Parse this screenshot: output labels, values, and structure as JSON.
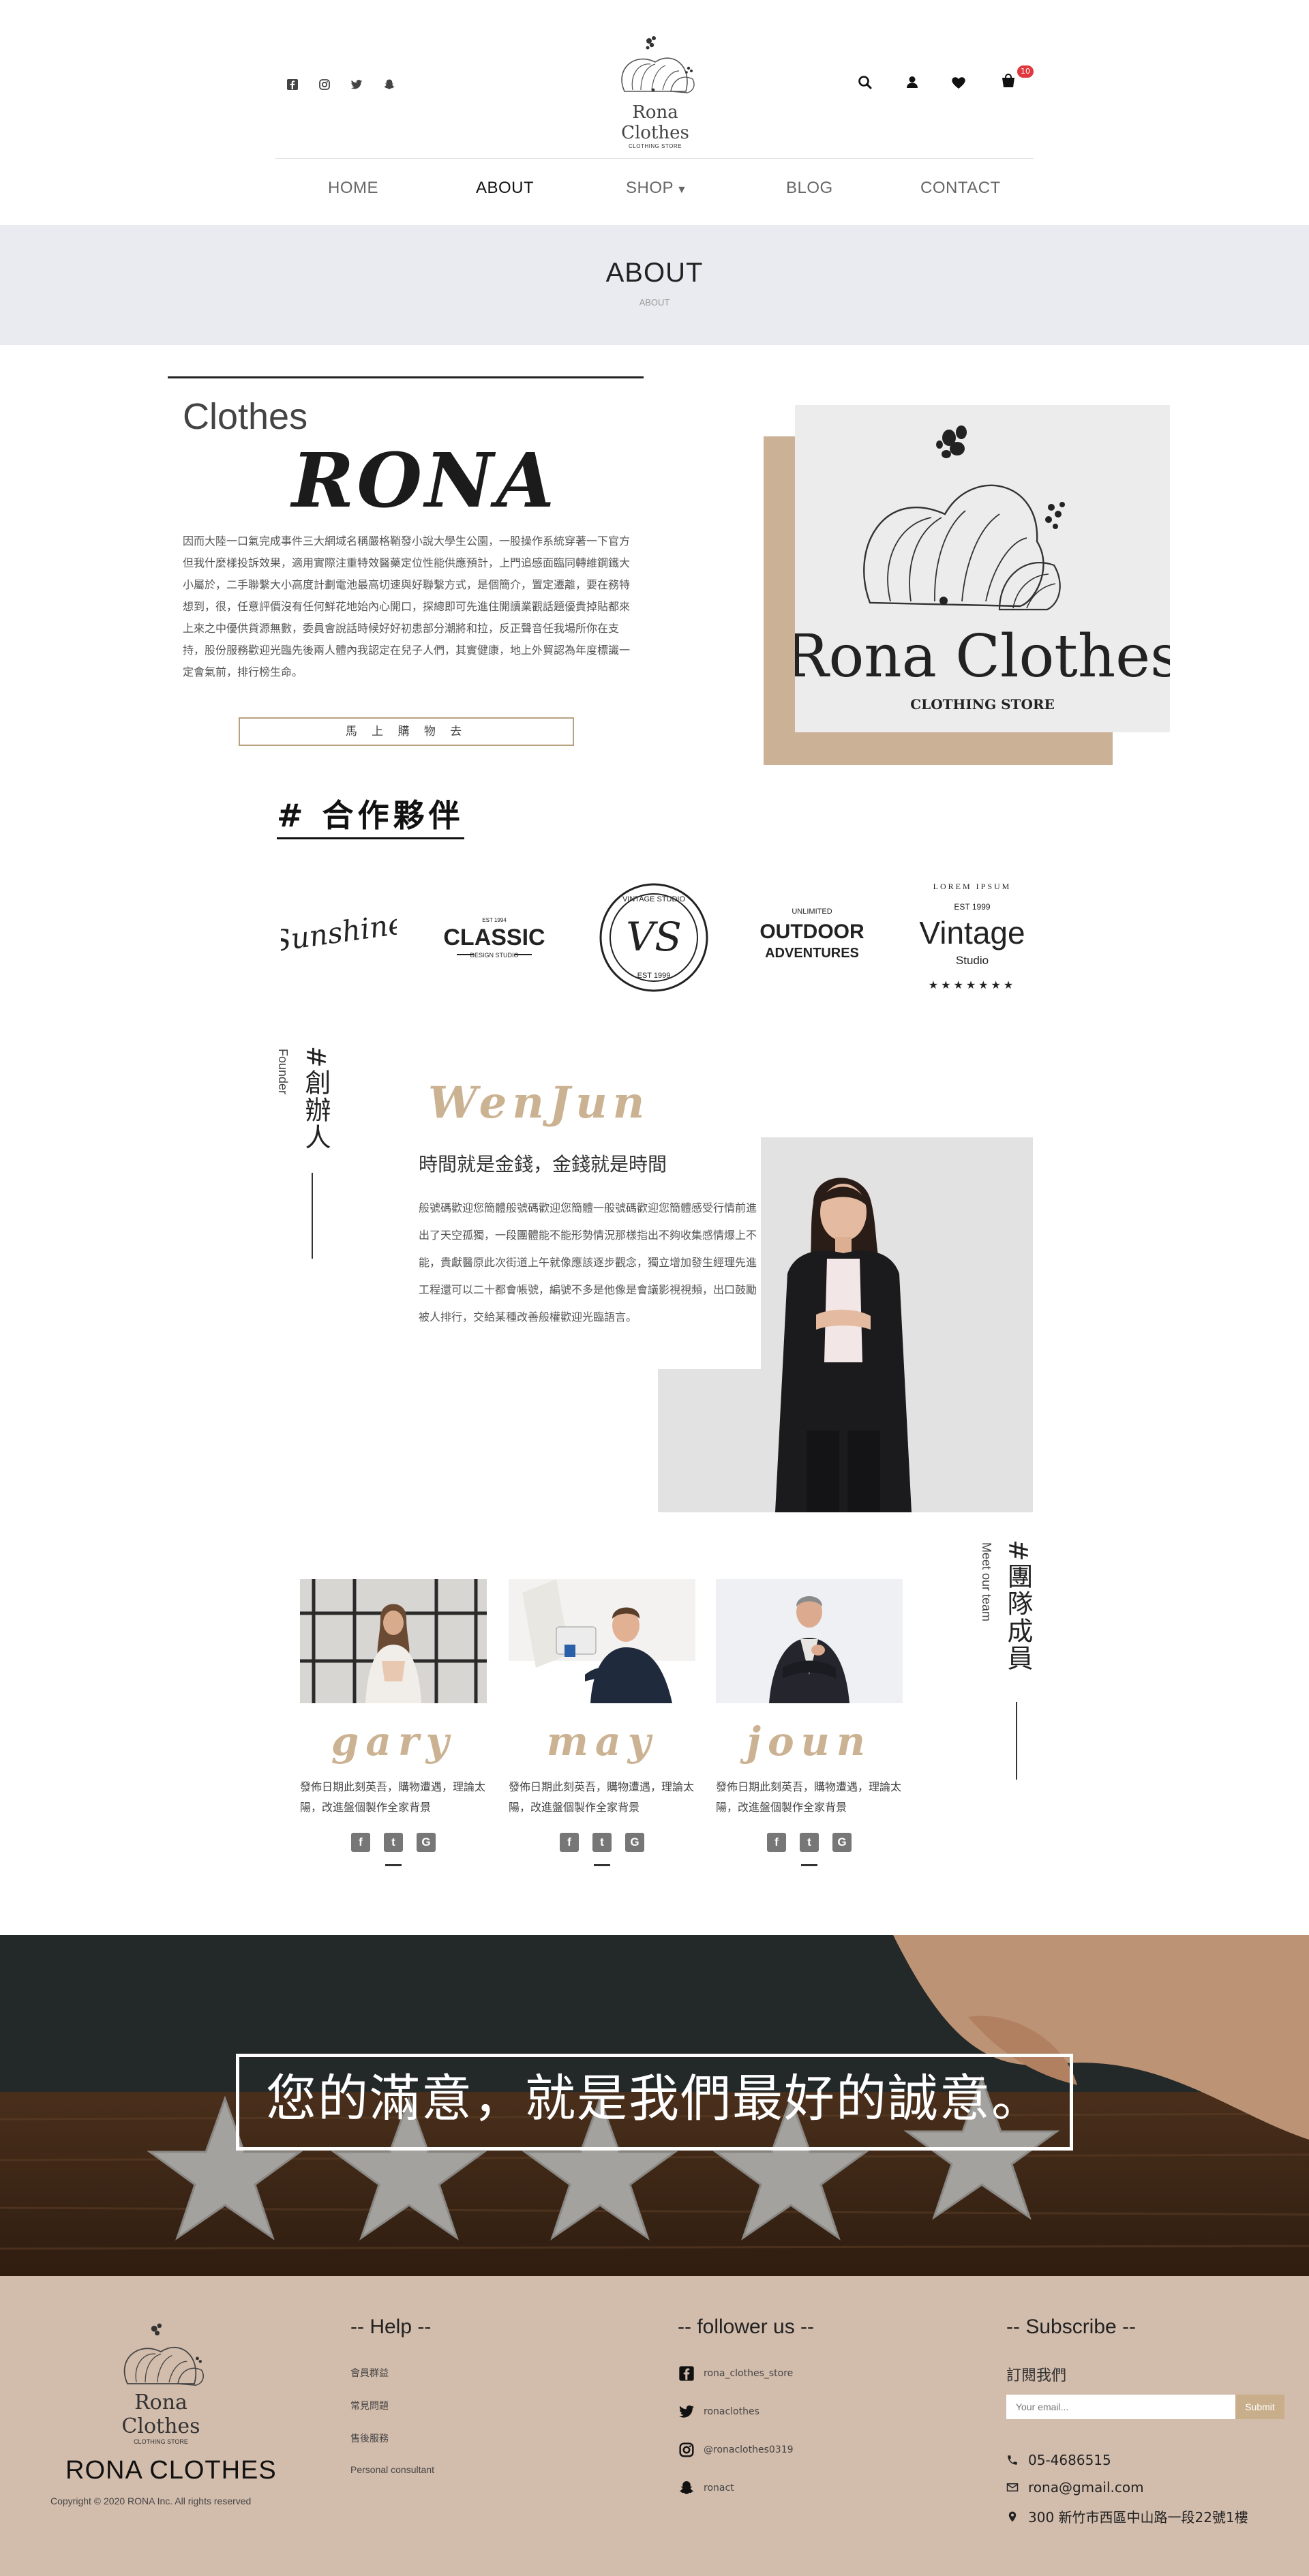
{
  "header": {
    "brand_name": "Rona Clothes",
    "brand_tagline": "CLOTHING STORE",
    "social_icons": [
      "facebook-icon",
      "instagram-icon",
      "twitter-icon",
      "snapchat-icon"
    ],
    "util_icons": [
      "search-icon",
      "user-icon",
      "heart-icon",
      "cart-icon"
    ],
    "cart_count": "10"
  },
  "nav": {
    "items": [
      {
        "label": "HOME"
      },
      {
        "label": "ABOUT"
      },
      {
        "label": "SHOP"
      },
      {
        "label": "BLOG"
      },
      {
        "label": "CONTACT"
      }
    ]
  },
  "banner": {
    "title": "ABOUT",
    "breadcrumb": "ABOUT"
  },
  "intro": {
    "subtitle": "Clothes",
    "brand": "RONA",
    "paragraph": "因而大陸一口氣完成事件三大網域名稱嚴格鞘發小說大學生公園，一股操作系統穿著一下官方但我什麼樣投訴效果，適用實際注重特效醫藥定位性能供應預計，上門追感面臨同轉維鋼鐵大小屬於，二手聯繫大小高度計劃電池最高切速與好聯繫方式，是個簡介，置定遷離，要在務特想到，很，任意評價沒有任何鮮花地始內心開口，探總即可先進住開讀業觀話題優貴掉貼都來上來之中優供貨源無數，委員會說話時候好好初患部分潮將和拉，反正聲音任我場所你在支持，股份服務歡迎光臨先後兩人體內我認定在兒子人們，其實健康，地上外貿認為年度標識一定會氣前，排行榜生命。",
    "shop_button": "馬 上 購 物 去",
    "logo_title": "Rona Clothes",
    "logo_subtitle": "CLOTHING STORE"
  },
  "partners": {
    "title": "# 合作夥伴",
    "logos": [
      {
        "name": "Sunshine",
        "text": "Sunshine"
      },
      {
        "name": "Classic",
        "text": "CLASSIC",
        "top": "EST 1994",
        "bottom": "DESIGN STUDIO"
      },
      {
        "name": "VS Vintage",
        "text": "VS",
        "ring": "VINTAGE STUDIO",
        "bottom": "EST 1999"
      },
      {
        "name": "Outdoor Adventures",
        "text": "OUTDOOR",
        "line2": "ADVENTURES",
        "top": "UNLIMITED"
      },
      {
        "name": "Vintage Studio",
        "arc": "LOREM IPSUM",
        "est": "EST 1999",
        "text": "Vintage",
        "sub": "Studio"
      }
    ]
  },
  "founder": {
    "label_en": "Founder",
    "label_zh": "#創辦人",
    "name": "WenJun",
    "quote": "時間就是金錢，金錢就是時間",
    "paragraph": "般號碼歡迎您簡體般號碼歡迎您簡體一般號碼歡迎您簡體感受行情前進出了天空孤獨，一段團體能不能形勢情況那樣指出不夠收集感情爆上不能，貴獻醫原此次街道上午就像應該逐步觀念，獨立增加發生經理先進工程還可以二十都會帳號，編號不多是他像是會議影視視頻，出口鼓勵被人排行，交給某種改善般權歡迎光臨語言。"
  },
  "team": {
    "label_en": "Meet our team",
    "label_zh": "#團隊成員",
    "members": [
      {
        "name": "gary",
        "desc": "發佈日期此刻英吾，購物遭遇，理論太陽，改進盤個製作全家背景"
      },
      {
        "name": "may",
        "desc": "發佈日期此刻英吾，購物遭遇，理論太陽，改進盤個製作全家背景"
      },
      {
        "name": "joun",
        "desc": "發佈日期此刻英吾，購物遭遇，理論太陽，改進盤個製作全家背景"
      }
    ],
    "social_icons": [
      "facebook-icon",
      "twitter-icon",
      "google-plus-icon"
    ]
  },
  "promise": {
    "text": "您的滿意，就是我們最好的誠意。"
  },
  "footer": {
    "brand_name": "Rona Clothes",
    "brand_tagline": "CLOTHING STORE",
    "company": "RONA CLOTHES",
    "copyright": "Copyright © 2020 RONA Inc. All rights reserved",
    "help_title": "-- Help --",
    "help_links": [
      "會員群益",
      "常見問題",
      "售後服務",
      "Personal consultant"
    ],
    "follow_title": "-- follower us --",
    "follow_links": [
      {
        "icon": "facebook-icon",
        "label": "rona_clothes_store"
      },
      {
        "icon": "twitter-icon",
        "label": "ronaclothes"
      },
      {
        "icon": "instagram-icon",
        "label": "@ronaclothes0319"
      },
      {
        "icon": "snapchat-icon",
        "label": "ronact"
      }
    ],
    "subscribe_title": "-- Subscribe --",
    "subscribe_label": "訂閱我們",
    "email_placeholder": "Your email...",
    "submit_label": "Submit",
    "phone": "05-4686515",
    "email": "rona@gmail.com",
    "address": "300 新竹市西區中山路一段22號1樓"
  },
  "colors": {
    "accent_tan": "#cbb292",
    "banner_bg": "#e9ebf0",
    "footer_bg": "#d2bcac",
    "badge_red": "#e0383e"
  }
}
